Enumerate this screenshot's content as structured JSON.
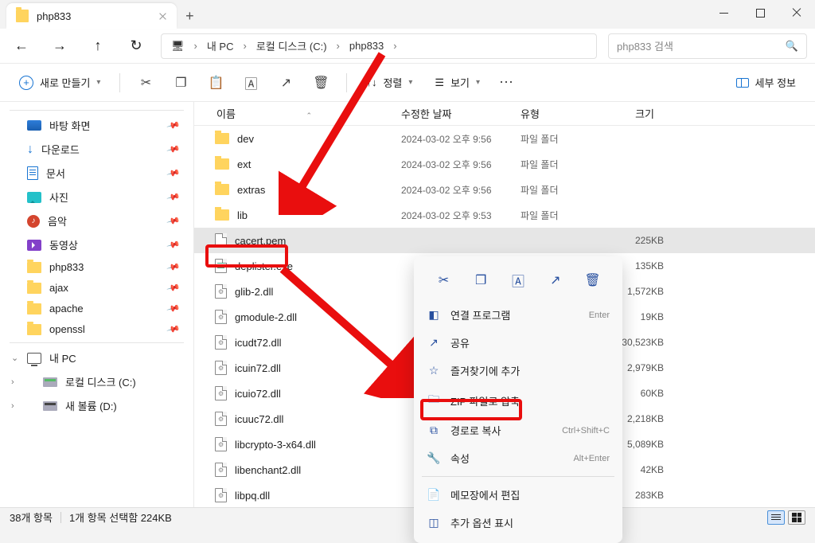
{
  "window": {
    "title": "php833"
  },
  "nav": {
    "crumbs": [
      "내 PC",
      "로컬 디스크 (C:)",
      "php833"
    ],
    "search_placeholder": "php833 검색"
  },
  "toolbar": {
    "new": "새로 만들기",
    "sort": "정렬",
    "view": "보기",
    "details": "세부 정보"
  },
  "sidebar": {
    "quick": [
      {
        "label": "바탕 화면",
        "icon": "desktop"
      },
      {
        "label": "다운로드",
        "icon": "download"
      },
      {
        "label": "문서",
        "icon": "doc"
      },
      {
        "label": "사진",
        "icon": "pic"
      },
      {
        "label": "음악",
        "icon": "music"
      },
      {
        "label": "동영상",
        "icon": "video"
      },
      {
        "label": "php833",
        "icon": "folder"
      },
      {
        "label": "ajax",
        "icon": "folder"
      },
      {
        "label": "apache",
        "icon": "folder"
      },
      {
        "label": "openssl",
        "icon": "folder"
      }
    ],
    "pc": "내 PC",
    "drives": [
      {
        "label": "로컬 디스크 (C:)",
        "kind": "green"
      },
      {
        "label": "새 볼륨 (D:)",
        "kind": "dark"
      }
    ]
  },
  "columns": {
    "name": "이름",
    "date": "수정한 날짜",
    "type": "유형",
    "size": "크기"
  },
  "files": [
    {
      "name": "dev",
      "date": "2024-03-02 오후 9:56",
      "type": "파일 폴더",
      "size": "",
      "icon": "folder"
    },
    {
      "name": "ext",
      "date": "2024-03-02 오후 9:56",
      "type": "파일 폴더",
      "size": "",
      "icon": "folder"
    },
    {
      "name": "extras",
      "date": "2024-03-02 오후 9:56",
      "type": "파일 폴더",
      "size": "",
      "icon": "folder"
    },
    {
      "name": "lib",
      "date": "2024-03-02 오후 9:53",
      "type": "파일 폴더",
      "size": "",
      "icon": "folder"
    },
    {
      "name": "cacert.pem",
      "date": "",
      "type": "",
      "size": "225KB",
      "icon": "file",
      "selected": true
    },
    {
      "name": "deplister.exe",
      "date": "",
      "type": "",
      "size": "135KB",
      "icon": "exe"
    },
    {
      "name": "glib-2.dll",
      "date": "",
      "type": "",
      "size": "1,572KB",
      "icon": "dll"
    },
    {
      "name": "gmodule-2.dll",
      "date": "",
      "type": "",
      "size": "19KB",
      "icon": "dll"
    },
    {
      "name": "icudt72.dll",
      "date": "",
      "type": "",
      "size": "30,523KB",
      "icon": "dll"
    },
    {
      "name": "icuin72.dll",
      "date": "",
      "type": "",
      "size": "2,979KB",
      "icon": "dll"
    },
    {
      "name": "icuio72.dll",
      "date": "",
      "type": "",
      "size": "60KB",
      "icon": "dll"
    },
    {
      "name": "icuuc72.dll",
      "date": "",
      "type": "",
      "size": "2,218KB",
      "icon": "dll"
    },
    {
      "name": "libcrypto-3-x64.dll",
      "date": "",
      "type": "",
      "size": "5,089KB",
      "icon": "dll"
    },
    {
      "name": "libenchant2.dll",
      "date": "",
      "type": "",
      "size": "42KB",
      "icon": "dll"
    },
    {
      "name": "libpq.dll",
      "date": "",
      "type": "",
      "size": "283KB",
      "icon": "dll"
    }
  ],
  "context_menu": {
    "open_with": "연결 프로그램",
    "open_with_key": "Enter",
    "share": "공유",
    "favorites": "즐겨찾기에 추가",
    "zip": "ZIP 파일로 압축",
    "copy_path": "경로로 복사",
    "copy_path_key": "Ctrl+Shift+C",
    "properties": "속성",
    "properties_key": "Alt+Enter",
    "edit_notepad": "메모장에서 편집",
    "more": "추가 옵션 표시"
  },
  "status": {
    "count": "38개 항목",
    "selected": "1개 항목 선택함 224KB"
  }
}
